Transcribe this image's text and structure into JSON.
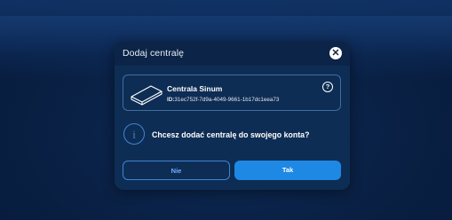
{
  "dialog": {
    "title": "Dodaj centralę",
    "close_icon": "close-icon"
  },
  "device": {
    "icon": "router-device-icon",
    "name": "Centrala Sinum",
    "id_label": "ID:",
    "id_value": "31ec752f-7d9a-4049-9661-1b17dc1eea73",
    "help_icon": "help-icon",
    "help_glyph": "?"
  },
  "confirm": {
    "info_icon": "info-icon",
    "info_glyph": "i",
    "question": "Chcesz dodać centralę do swojego konta?"
  },
  "buttons": {
    "no_label": "Nie",
    "yes_label": "Tak"
  },
  "colors": {
    "background": "#0a2247",
    "modal": "#0e2d54",
    "header": "#0b2447",
    "accent": "#1e88e5",
    "outline": "#3f84d6"
  }
}
